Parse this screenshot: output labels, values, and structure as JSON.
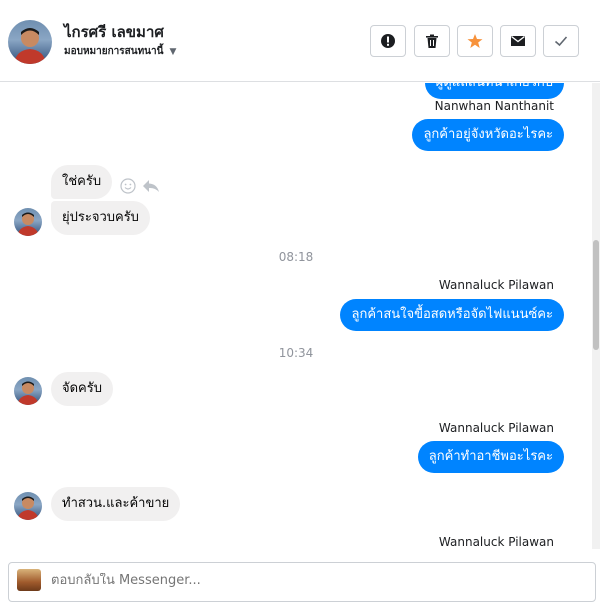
{
  "header": {
    "contact_name": "ไกรศรี เลขมาศ",
    "assign_label": "มอบหมายการสนทนานี้",
    "buttons": {
      "spam": "exclamation-icon",
      "delete": "trash-icon",
      "star": "star-icon",
      "unread": "envelope-icon",
      "done": "check-icon"
    },
    "star_color": "#f7923b"
  },
  "thread": {
    "top_partial": "ผู้ดูแลสนทนาเกี่ยวกับ",
    "sender1": "Nanwhan Nanthanit",
    "msg1": "ลูกค้าอยู่จังหวัดอะไรคะ",
    "msg2": "ใช่ครับ",
    "msg3": "ยุ่ประจวบครับ",
    "time1": "08:18",
    "sender2": "Wannaluck Pilawan",
    "msg4": "ลูกค้าสนใจขื้อสดหรือจัดไฟแนนซ์คะ",
    "time2": "10:34",
    "msg5": "จัดครับ",
    "sender3": "Wannaluck Pilawan",
    "msg6": "ลูกค้าทำอาชีพอะไรคะ",
    "msg7": "ทำสวน.และค้าขาย",
    "sender4": "Wannaluck Pilawan"
  },
  "composer": {
    "placeholder": "ตอบกลับใน Messenger..."
  },
  "colors": {
    "outgoing_bubble": "#0084ff",
    "incoming_bubble": "#f1f0f0"
  }
}
